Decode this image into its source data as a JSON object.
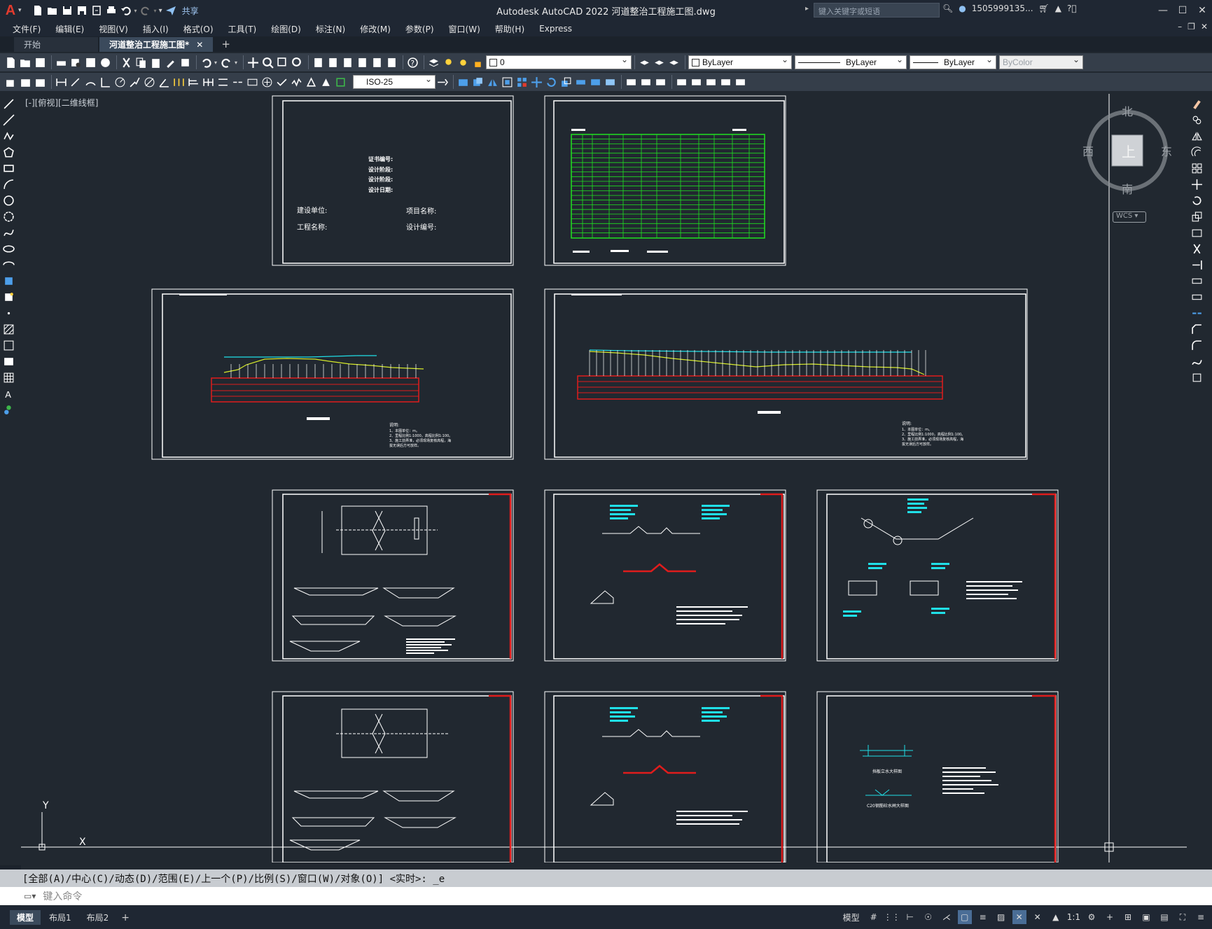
{
  "app": {
    "title": "Autodesk AutoCAD 2022    河道整治工程施工图.dwg",
    "share_label": "共享",
    "search_placeholder": "键入关键字或短语",
    "user": "1505999135...",
    "window_controls": [
      "minimize",
      "maximize",
      "close"
    ]
  },
  "menu": [
    "文件(F)",
    "编辑(E)",
    "视图(V)",
    "插入(I)",
    "格式(O)",
    "工具(T)",
    "绘图(D)",
    "标注(N)",
    "修改(M)",
    "参数(P)",
    "窗口(W)",
    "帮助(H)",
    "Express"
  ],
  "tabs": [
    {
      "label": "开始",
      "active": false
    },
    {
      "label": "河道整治工程施工图*",
      "active": true
    }
  ],
  "toolbar": {
    "layer_value": "0",
    "color_value": "ByLayer",
    "linetype_value": "ByLayer",
    "lineweight_value": "ByLayer",
    "plotstyle_value": "ByColor",
    "dimstyle_value": "ISO-25"
  },
  "viewport": {
    "label": "[-][俯视][二维线框]",
    "compass": {
      "north": "北",
      "south": "南",
      "east": "东",
      "west": "西",
      "center": "上",
      "ucs": "WCS"
    },
    "ucs_y": "Y",
    "ucs_x": "X"
  },
  "drawing": {
    "cover": {
      "approval": [
        "证书编号:",
        "设计阶段:",
        "设计阶段:",
        "设计日期:"
      ],
      "fields_left": [
        "建设单位:",
        "工程名称:"
      ],
      "fields_right": [
        "项目名称:",
        "设计编号:"
      ]
    },
    "notes_title": "说明:",
    "notes_lines": [
      "1、本图单位：m。",
      "2、里程比例1:1000，高程比例1:100。",
      "3、施工前弄准，必须现场复核高程，海",
      "拔无误后方可放样。"
    ],
    "detail_caption_1": "挡板立水大样图",
    "detail_caption_2": "C20钢筋砼水闸大样图"
  },
  "command": {
    "history": "[全部(A)/中心(C)/动态(D)/范围(E)/上一个(P)/比例(S)/窗口(W)/对象(O)] <实时>: _e",
    "placeholder": "键入命令"
  },
  "status": {
    "layout_tabs": [
      {
        "label": "模型",
        "active": true
      },
      {
        "label": "布局1",
        "active": false
      },
      {
        "label": "布局2",
        "active": false
      }
    ],
    "model_label": "模型",
    "scale": "1:1"
  }
}
